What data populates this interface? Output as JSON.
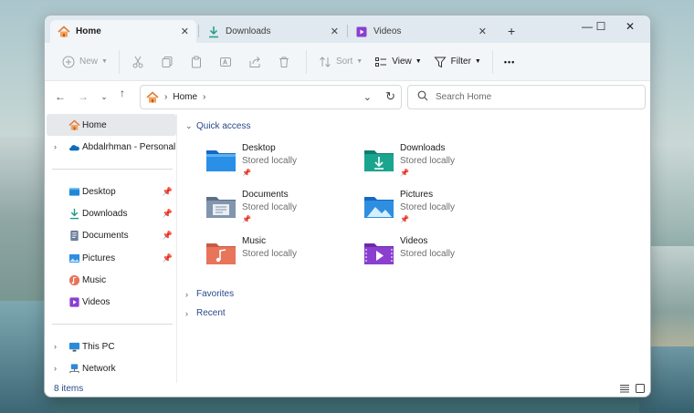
{
  "tabs": [
    {
      "label": "Home",
      "icon": "home-icon",
      "active": true
    },
    {
      "label": "Downloads",
      "icon": "download-icon",
      "active": false
    },
    {
      "label": "Videos",
      "icon": "videos-icon",
      "active": false
    }
  ],
  "new_tab_label": "+",
  "window_controls": {
    "minimize": "—",
    "maximize": "☐",
    "close": "✕"
  },
  "toolbar": {
    "new_label": "New",
    "sort_label": "Sort",
    "view_label": "View",
    "filter_label": "Filter",
    "more_label": "•••"
  },
  "address": {
    "crumb": "Home",
    "search_placeholder": "Search Home"
  },
  "sidebar": {
    "items": [
      {
        "label": "Home",
        "icon": "home-icon",
        "selected": true
      },
      {
        "label": "Abdalrhman - Personal",
        "icon": "onedrive-cloud-icon"
      },
      {
        "label": "Desktop",
        "icon": "desktop-folder-icon",
        "pinned": true
      },
      {
        "label": "Downloads",
        "icon": "download-icon",
        "pinned": true
      },
      {
        "label": "Documents",
        "icon": "documents-icon",
        "pinned": true
      },
      {
        "label": "Pictures",
        "icon": "pictures-icon",
        "pinned": true
      },
      {
        "label": "Music",
        "icon": "music-icon"
      },
      {
        "label": "Videos",
        "icon": "videos-icon"
      },
      {
        "label": "This PC",
        "icon": "monitor-icon"
      },
      {
        "label": "Network",
        "icon": "network-icon"
      }
    ]
  },
  "content": {
    "quick_access_label": "Quick access",
    "favorites_label": "Favorites",
    "recent_label": "Recent",
    "items": [
      {
        "name": "Desktop",
        "sub": "Stored locally",
        "pinned": true,
        "icon": "desktop-folder-icon"
      },
      {
        "name": "Downloads",
        "sub": "Stored locally",
        "pinned": true,
        "icon": "downloads-folder-icon"
      },
      {
        "name": "Documents",
        "sub": "Stored locally",
        "pinned": true,
        "icon": "documents-folder-icon"
      },
      {
        "name": "Pictures",
        "sub": "Stored locally",
        "pinned": true,
        "icon": "pictures-folder-icon"
      },
      {
        "name": "Music",
        "sub": "Stored locally",
        "pinned": false,
        "icon": "music-folder-icon"
      },
      {
        "name": "Videos",
        "sub": "Stored locally",
        "pinned": false,
        "icon": "videos-folder-icon"
      }
    ]
  },
  "status": {
    "items_count": "8 items"
  },
  "colors": {
    "accent": "#2a4a8a",
    "titlebar": "#dfe9ef",
    "toolbar": "#f3f6f8",
    "selected": "#e5e9ec"
  }
}
